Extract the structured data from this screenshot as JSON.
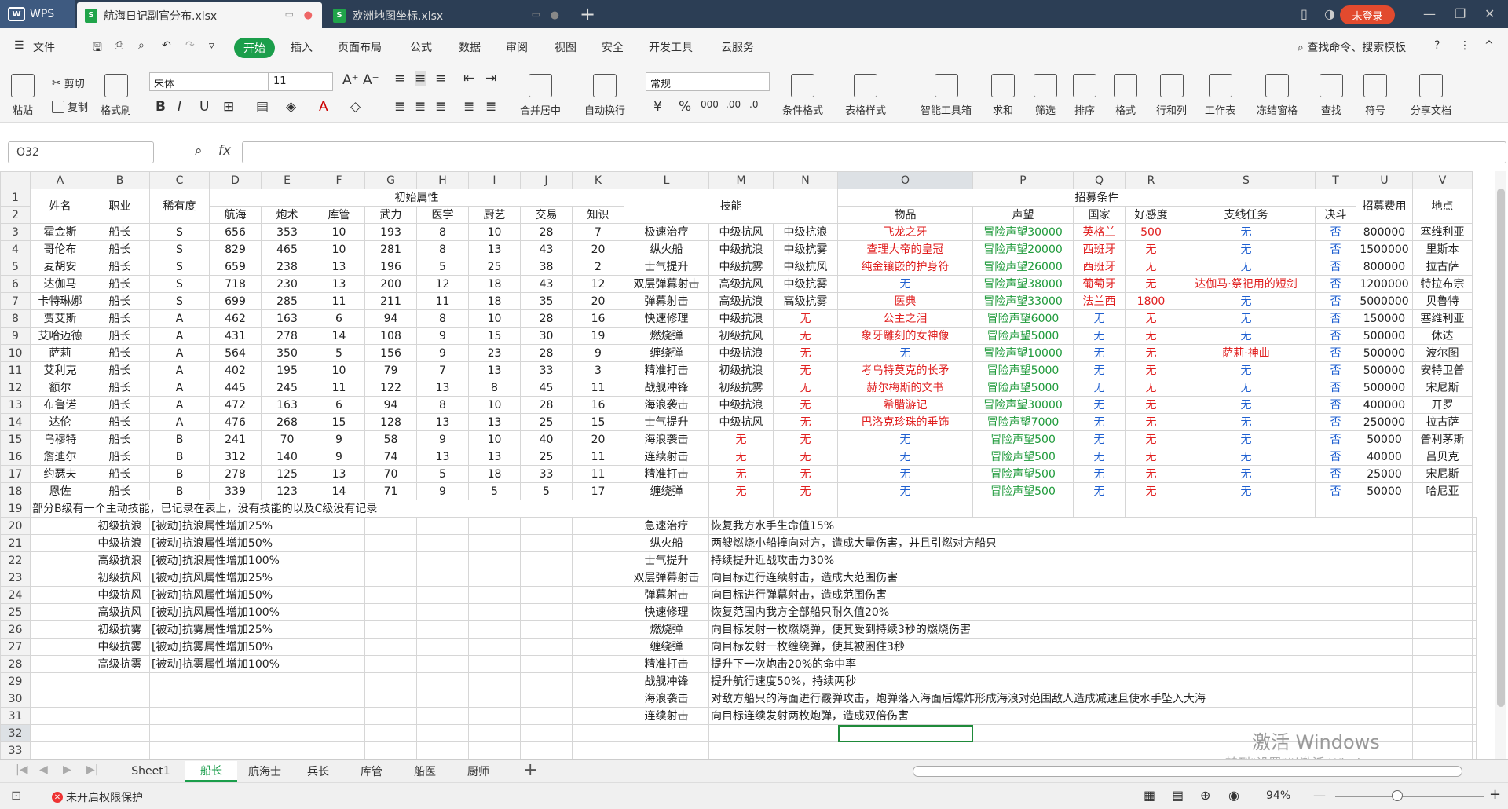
{
  "titlebar": {
    "app_label": "WPS",
    "tabs": [
      {
        "label": "航海日记副官分布.xlsx"
      },
      {
        "label": "欧洲地图坐标.xlsx"
      }
    ],
    "login_label": "未登录"
  },
  "menu": {
    "file_label": "文件",
    "start_label": "开始",
    "items": [
      "插入",
      "页面布局",
      "公式",
      "数据",
      "审阅",
      "视图",
      "安全",
      "开发工具",
      "云服务"
    ],
    "search_label": "查找命令、搜索模板"
  },
  "ribbon": {
    "paste": "粘贴",
    "cut": "剪切",
    "copy": "复制",
    "format_painter": "格式刷",
    "font_name": "宋体",
    "font_size": "11",
    "number_format": "常规",
    "merge": "合并居中",
    "wrap": "自动换行",
    "cond_format": "条件格式",
    "table_style": "表格样式",
    "smart_toolbox": "智能工具箱",
    "sum": "求和",
    "filter": "筛选",
    "sort": "排序",
    "format": "格式",
    "rowcol": "行和列",
    "worksheet": "工作表",
    "freeze": "冻结窗格",
    "find": "查找",
    "symbol": "符号",
    "share": "分享文档"
  },
  "formula_bar": {
    "name_box": "O32",
    "fx": "fx",
    "formula": ""
  },
  "columns": [
    "A",
    "B",
    "C",
    "D",
    "E",
    "F",
    "G",
    "H",
    "I",
    "J",
    "K",
    "L",
    "M",
    "N",
    "O",
    "P",
    "Q",
    "R",
    "S",
    "T",
    "U",
    "V"
  ],
  "header": {
    "name": "姓名",
    "job": "职业",
    "rarity": "稀有度",
    "initial_attrs": "初始属性",
    "skills": "技能",
    "recruit_cond": "招募条件",
    "recruit_fee": "招募费用",
    "location": "地点",
    "attrs": [
      "航海",
      "炮术",
      "库管",
      "武力",
      "医学",
      "厨艺",
      "交易",
      "知识"
    ],
    "conds": [
      "物品",
      "声望",
      "国家",
      "好感度",
      "支线任务",
      "决斗"
    ]
  },
  "rows": [
    [
      "霍金斯",
      "船长",
      "S",
      "656",
      "353",
      "10",
      "193",
      "8",
      "10",
      "28",
      "7",
      "极速治疗",
      "中级抗风",
      "中级抗浪",
      "飞龙之牙",
      "冒险声望30000",
      "英格兰",
      "500",
      "无",
      "否",
      "800000",
      "塞维利亚"
    ],
    [
      "哥伦布",
      "船长",
      "S",
      "829",
      "465",
      "10",
      "281",
      "8",
      "13",
      "43",
      "20",
      "纵火船",
      "中级抗浪",
      "中级抗雾",
      "查理大帝的皇冠",
      "冒险声望20000",
      "西班牙",
      "无",
      "无",
      "否",
      "1500000",
      "里斯本"
    ],
    [
      "麦胡安",
      "船长",
      "S",
      "659",
      "238",
      "13",
      "196",
      "5",
      "25",
      "38",
      "2",
      "士气提升",
      "中级抗雾",
      "中级抗风",
      "纯金镶嵌的护身符",
      "冒险声望26000",
      "西班牙",
      "无",
      "无",
      "否",
      "800000",
      "拉古萨"
    ],
    [
      "达伽马",
      "船长",
      "S",
      "718",
      "230",
      "13",
      "200",
      "12",
      "18",
      "43",
      "12",
      "双层弹幕射击",
      "高级抗风",
      "中级抗雾",
      "无",
      "冒险声望38000",
      "葡萄牙",
      "无",
      "达伽马·祭祀用的短剑",
      "否",
      "1200000",
      "特拉布宗"
    ],
    [
      "卡特琳娜",
      "船长",
      "S",
      "699",
      "285",
      "11",
      "211",
      "11",
      "18",
      "35",
      "20",
      "弹幕射击",
      "高级抗浪",
      "高级抗雾",
      "医典",
      "冒险声望33000",
      "法兰西",
      "1800",
      "无",
      "否",
      "5000000",
      "贝鲁特"
    ],
    [
      "贾艾斯",
      "船长",
      "A",
      "462",
      "163",
      "6",
      "94",
      "8",
      "10",
      "28",
      "16",
      "快速修理",
      "中级抗浪",
      "无",
      "公主之泪",
      "冒险声望6000",
      "无",
      "无",
      "无",
      "否",
      "150000",
      "塞维利亚"
    ],
    [
      "艾哈迈德",
      "船长",
      "A",
      "431",
      "278",
      "14",
      "108",
      "9",
      "15",
      "30",
      "19",
      "燃烧弹",
      "初级抗风",
      "无",
      "象牙雕刻的女神像",
      "冒险声望5000",
      "无",
      "无",
      "无",
      "否",
      "500000",
      "休达"
    ],
    [
      "萨莉",
      "船长",
      "A",
      "564",
      "350",
      "5",
      "156",
      "9",
      "23",
      "28",
      "9",
      "缠绕弹",
      "中级抗浪",
      "无",
      "无",
      "冒险声望10000",
      "无",
      "无",
      "萨莉·神曲",
      "否",
      "500000",
      "波尔图"
    ],
    [
      "艾利克",
      "船长",
      "A",
      "402",
      "195",
      "10",
      "79",
      "7",
      "13",
      "33",
      "3",
      "精准打击",
      "初级抗浪",
      "无",
      "考乌特莫克的长矛",
      "冒险声望5000",
      "无",
      "无",
      "无",
      "否",
      "500000",
      "安特卫普"
    ],
    [
      "额尔",
      "船长",
      "A",
      "445",
      "245",
      "11",
      "122",
      "13",
      "8",
      "45",
      "11",
      "战舰冲锋",
      "初级抗雾",
      "无",
      "赫尔梅斯的文书",
      "冒险声望5000",
      "无",
      "无",
      "无",
      "否",
      "500000",
      "宋尼斯"
    ],
    [
      "布鲁诺",
      "船长",
      "A",
      "472",
      "163",
      "6",
      "94",
      "8",
      "10",
      "28",
      "16",
      "海浪袭击",
      "中级抗浪",
      "无",
      "希腊游记",
      "冒险声望30000",
      "无",
      "无",
      "无",
      "否",
      "400000",
      "开罗"
    ],
    [
      "达伦",
      "船长",
      "A",
      "476",
      "268",
      "15",
      "128",
      "13",
      "13",
      "25",
      "15",
      "士气提升",
      "中级抗风",
      "无",
      "巴洛克珍珠的垂饰",
      "冒险声望7000",
      "无",
      "无",
      "无",
      "否",
      "250000",
      "拉古萨"
    ],
    [
      "乌穆特",
      "船长",
      "B",
      "241",
      "70",
      "9",
      "58",
      "9",
      "10",
      "40",
      "20",
      "海浪袭击",
      "无",
      "无",
      "无",
      "冒险声望500",
      "无",
      "无",
      "无",
      "否",
      "50000",
      "普利茅斯"
    ],
    [
      "詹迪尔",
      "船长",
      "B",
      "312",
      "140",
      "9",
      "74",
      "13",
      "13",
      "25",
      "11",
      "连续射击",
      "无",
      "无",
      "无",
      "冒险声望500",
      "无",
      "无",
      "无",
      "否",
      "40000",
      "吕贝克"
    ],
    [
      "约瑟夫",
      "船长",
      "B",
      "278",
      "125",
      "13",
      "70",
      "5",
      "18",
      "33",
      "11",
      "精准打击",
      "无",
      "无",
      "无",
      "冒险声望500",
      "无",
      "无",
      "无",
      "否",
      "25000",
      "宋尼斯"
    ],
    [
      "恩佐",
      "船长",
      "B",
      "339",
      "123",
      "14",
      "71",
      "9",
      "5",
      "5",
      "17",
      "缠绕弹",
      "无",
      "无",
      "无",
      "冒险声望500",
      "无",
      "无",
      "无",
      "否",
      "50000",
      "哈尼亚"
    ]
  ],
  "note_row": "部分B级有一个主动技能，已记录在表上，没有技能的以及C级没有记录",
  "passives": [
    [
      "初级抗浪",
      "[被动]抗浪属性增加25%"
    ],
    [
      "中级抗浪",
      "[被动]抗浪属性增加50%"
    ],
    [
      "高级抗浪",
      "[被动]抗浪属性增加100%"
    ],
    [
      "初级抗风",
      "[被动]抗风属性增加25%"
    ],
    [
      "中级抗风",
      "[被动]抗风属性增加50%"
    ],
    [
      "高级抗风",
      "[被动]抗风属性增加100%"
    ],
    [
      "初级抗雾",
      "[被动]抗雾属性增加25%"
    ],
    [
      "中级抗雾",
      "[被动]抗雾属性增加50%"
    ],
    [
      "高级抗雾",
      "[被动]抗雾属性增加100%"
    ]
  ],
  "actives": [
    [
      "急速治疗",
      "恢复我方水手生命值15%"
    ],
    [
      "纵火船",
      "两艘燃烧小船撞向对方，造成大量伤害，并且引燃对方船只"
    ],
    [
      "士气提升",
      "持续提升近战攻击力30%"
    ],
    [
      "双层弹幕射击",
      "向目标进行连续射击，造成大范围伤害"
    ],
    [
      "弹幕射击",
      "向目标进行弹幕射击，造成范围伤害"
    ],
    [
      "快速修理",
      "恢复范围内我方全部船只耐久值20%"
    ],
    [
      "燃烧弹",
      "向目标发射一枚燃烧弹，使其受到持续3秒的燃烧伤害"
    ],
    [
      "缠绕弹",
      "向目标发射一枚缠绕弹，使其被困住3秒"
    ],
    [
      "精准打击",
      "提升下一次炮击20%的命中率"
    ],
    [
      "战舰冲锋",
      "提升航行速度50%，持续两秒"
    ],
    [
      "海浪袭击",
      "对敌方船只的海面进行霰弹攻击，炮弹落入海面后爆炸形成海浪对范围敌人造成减速且使水手坠入大海"
    ],
    [
      "连续射击",
      "向目标连续发射两枚炮弹，造成双倍伤害"
    ]
  ],
  "sheets": [
    "Sheet1",
    "船长",
    "航海士",
    "兵长",
    "库管",
    "船医",
    "厨师"
  ],
  "active_sheet": "船长",
  "status": {
    "permission": "未开启权限保护",
    "zoom": "94%"
  },
  "watermark": {
    "line1": "激活 Windows",
    "line2": "转到\"设置\"以激活 Windows。"
  }
}
